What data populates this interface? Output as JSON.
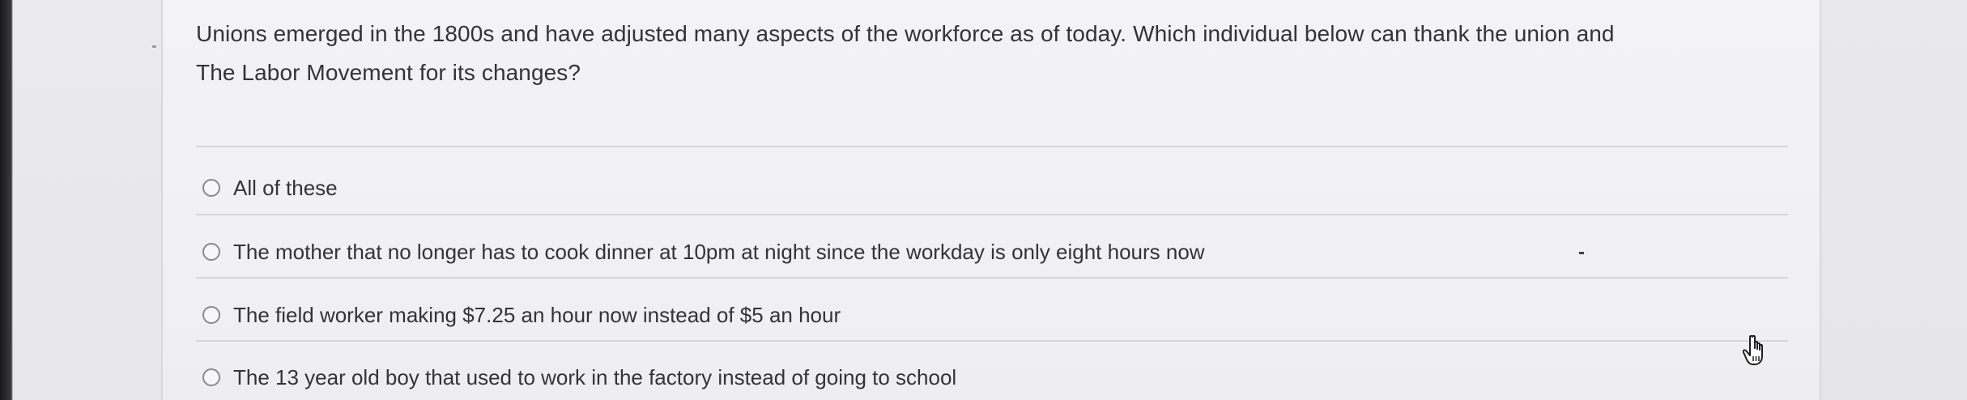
{
  "question": {
    "text_line1": "Unions emerged in the 1800s and have adjusted many aspects of the workforce as of today. Which individual below can thank the union and",
    "text_line2": "The Labor Movement for its changes?"
  },
  "options": [
    {
      "label": "All of these"
    },
    {
      "label": "The mother that no longer has to cook dinner at 10pm at night since the workday is only eight hours now"
    },
    {
      "label": "The field worker making $7.25 an hour now instead of $5 an hour"
    },
    {
      "label": "The 13 year old boy that used to work in the factory instead of going to school"
    }
  ],
  "icons": {
    "cursor": "hand-pointer-icon",
    "radio": "radio-unselected"
  },
  "colors": {
    "text": "#333338",
    "radio_border": "#8a8a90",
    "divider": "#d6d6da"
  }
}
